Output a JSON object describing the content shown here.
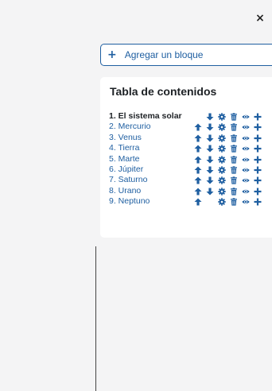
{
  "drawer": {
    "close_label": "×",
    "add_block_icon": "plus-icon",
    "add_block_label": "Agregar un bloque"
  },
  "toc": {
    "title": "Tabla de contenidos",
    "items": [
      {
        "label": "1. El sistema solar",
        "up": false,
        "down": true
      },
      {
        "label": "2. Mercurio",
        "up": true,
        "down": true
      },
      {
        "label": "3. Venus",
        "up": true,
        "down": true
      },
      {
        "label": "4. Tierra",
        "up": true,
        "down": true
      },
      {
        "label": "5. Marte",
        "up": true,
        "down": true
      },
      {
        "label": "6. Júpiter",
        "up": true,
        "down": true
      },
      {
        "label": "7. Saturno",
        "up": true,
        "down": true
      },
      {
        "label": "8. Urano",
        "up": true,
        "down": true
      },
      {
        "label": "9. Neptuno",
        "up": true,
        "down": false
      }
    ]
  },
  "colors": {
    "accent": "#1f5fa1",
    "panel_bg": "#f4f4f5",
    "text_dark": "#1d2125"
  }
}
